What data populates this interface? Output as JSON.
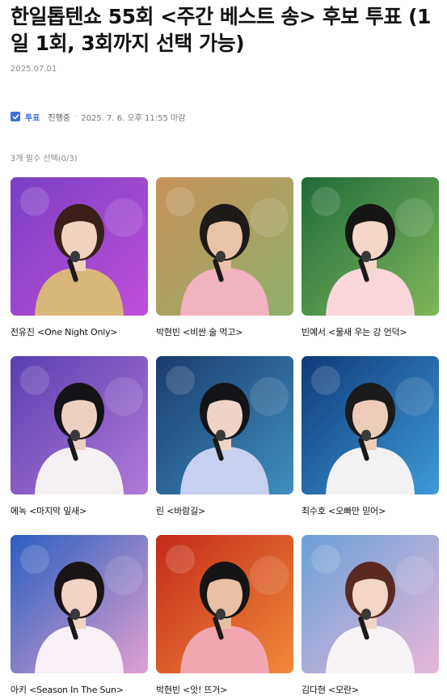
{
  "poll": {
    "title": "한일톱텐쇼 55회 <주간 베스트 송> 후보 투표 (1일 1회, 3회까지 선택 가능)",
    "date": "2025.07.01",
    "vote_tag": "투표",
    "status": "진행중",
    "deadline": "2025. 7. 6. 오후 11:55 마감",
    "required_note": "3개 필수 선택(0/3)"
  },
  "candidates": [
    {
      "label": "전유진 <One Night Only>",
      "bg": "#7a3fc4",
      "bg2": "#c04fd8",
      "hair": "#3a2018",
      "skin": "#f1d2c0",
      "outfit": "#d9b67a"
    },
    {
      "label": "박현빈 <비싼 술 먹고>",
      "bg": "#c9915a",
      "bg2": "#8fb06a",
      "hair": "#1e1a18",
      "skin": "#e9c3a6",
      "outfit": "#f2b3c0"
    },
    {
      "label": "빈예서 <물새 우는 강 언덕>",
      "bg": "#1f6b3a",
      "bg2": "#7fb85a",
      "hair": "#151515",
      "skin": "#f3d7c8",
      "outfit": "#fbd7dc"
    },
    {
      "label": "에녹 <마지막 잎새>",
      "bg": "#5a3fb0",
      "bg2": "#b07ad8",
      "hair": "#141418",
      "skin": "#ecd0c0",
      "outfit": "#f4f0f4"
    },
    {
      "label": "린 <바람길>",
      "bg": "#1a3b6e",
      "bg2": "#3f8fc0",
      "hair": "#141418",
      "skin": "#efd3c6",
      "outfit": "#c7d0f0"
    },
    {
      "label": "최수호 <오빠만 믿어>",
      "bg": "#0f3a7a",
      "bg2": "#3f9ad8",
      "hair": "#1a1a1a",
      "skin": "#ecccb8",
      "outfit": "#f2f2f4"
    },
    {
      "label": "아키 <Season In The Sun>",
      "bg": "#2a5fc0",
      "bg2": "#e0a0d0",
      "hair": "#1a1418",
      "skin": "#f2d3c4",
      "outfit": "#f8f0f6"
    },
    {
      "label": "박현빈 <앗! 뜨거>",
      "bg": "#c42a1a",
      "bg2": "#f08a3a",
      "hair": "#151515",
      "skin": "#e9c0a3",
      "outfit": "#f2a6b0"
    },
    {
      "label": "김다현 <모란>",
      "bg": "#6aa0d8",
      "bg2": "#e8b8d8",
      "hair": "#5a2a22",
      "skin": "#f3d6c8",
      "outfit": "#f7f2f6"
    }
  ]
}
